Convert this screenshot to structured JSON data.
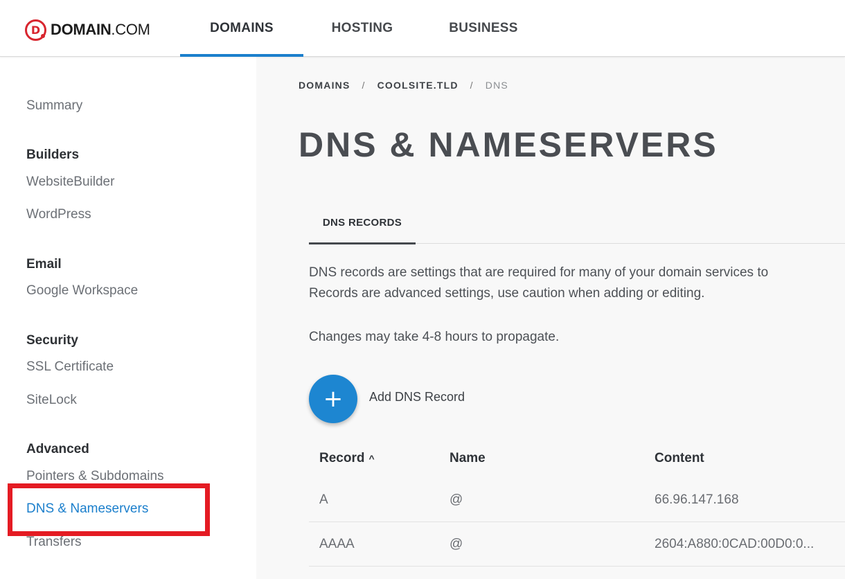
{
  "header": {
    "logo_letter": "D",
    "logo_bold": "DOMAIN",
    "logo_suffix": ".COM",
    "nav": [
      {
        "label": "DOMAINS",
        "active": true
      },
      {
        "label": "HOSTING",
        "active": false
      },
      {
        "label": "BUSINESS",
        "active": false
      }
    ]
  },
  "sidebar": {
    "summary": "Summary",
    "builders_heading": "Builders",
    "website_builder": "WebsiteBuilder",
    "wordpress": "WordPress",
    "email_heading": "Email",
    "google_workspace": "Google Workspace",
    "security_heading": "Security",
    "ssl_certificate": "SSL Certificate",
    "sitelock": "SiteLock",
    "advanced_heading": "Advanced",
    "pointers_subdomains": "Pointers & Subdomains",
    "dns_nameservers": "DNS & Nameservers",
    "transfers": "Transfers"
  },
  "breadcrumb": {
    "items": [
      "DOMAINS",
      "COOLSITE.TLD",
      "DNS"
    ],
    "separator": "/"
  },
  "page_title": "DNS & NAMESERVERS",
  "tabs": [
    {
      "label": "DNS RECORDS",
      "active": true
    }
  ],
  "description": {
    "line1": "DNS records are settings that are required for many of your domain services to",
    "line2": "Records are advanced settings, use caution when adding or editing.",
    "propagation": "Changes may take 4-8 hours to propagate."
  },
  "add_record": {
    "icon": "plus-icon",
    "label": "Add DNS Record"
  },
  "records_table": {
    "columns": [
      "Record",
      "Name",
      "Content"
    ],
    "sort_indicator": "^",
    "rows": [
      {
        "type": "A",
        "name": "@",
        "content": "66.96.147.168"
      },
      {
        "type": "AAAA",
        "name": "@",
        "content": "2604:A880:0CAD:00D0:0..."
      }
    ]
  },
  "colors": {
    "accent_blue": "#1b7fcc",
    "brand_red": "#d8262f",
    "highlight_red": "#e41b23"
  }
}
